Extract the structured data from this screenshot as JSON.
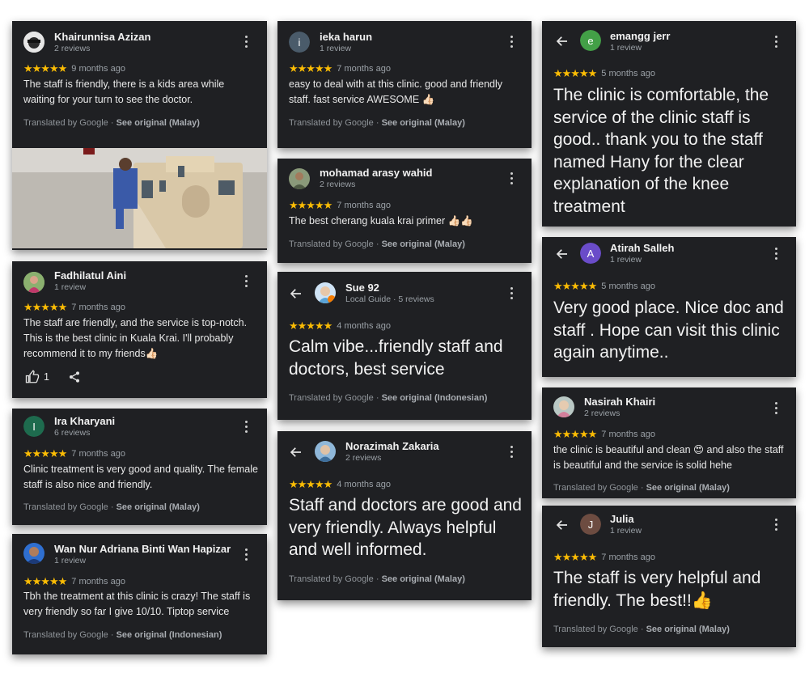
{
  "reviews": [
    {
      "name": "Khairunnisa Azizan",
      "sub": "2 reviews",
      "stars": "★★★★★",
      "when": "9 months ago",
      "text": "The staff is friendly, there is a kids area while waiting for your turn to see the doctor.",
      "translated": "Translated by Google",
      "see": "See original (Malay)",
      "sep": "·",
      "avatar_icon": "person-photo"
    },
    {
      "name": "Fadhilatul Aini",
      "sub": "1 review",
      "stars": "★★★★★",
      "when": "7 months ago",
      "text": "The staff are friendly, and the service is top-notch. This is the best clinic in Kuala Krai. I'll probably recommend it to my friends👍🏻",
      "likes": "1",
      "avatar_icon": "person-photo"
    },
    {
      "name": "Ira Kharyani",
      "sub": "6 reviews",
      "stars": "★★★★★",
      "when": "7 months ago",
      "text": "Clinic treatment is very good and quality. The female staff is also nice and friendly.",
      "translated": "Translated by Google",
      "see": "See original (Malay)",
      "sep": "·",
      "initial": "I",
      "avatar_color": "#1e6b4e"
    },
    {
      "name": "Wan Nur Adriana Binti Wan Hapizar",
      "sub": "1 review",
      "stars": "★★★★★",
      "when": "7 months ago",
      "text": "Tbh the treatment at this clinic is crazy! The staff is very friendly so far I give 10/10. Tiptop service",
      "translated": "Translated by Google",
      "see": "See original (Indonesian)",
      "sep": "·",
      "avatar_icon": "person-photo"
    },
    {
      "name": "ieka harun",
      "sub": "1 review",
      "stars": "★★★★★",
      "when": "7 months ago",
      "text": "easy to deal with at this clinic. good and friendly staff. fast service AWESOME 👍🏻",
      "translated": "Translated by Google",
      "see": "See original (Malay)",
      "sep": "·",
      "initial": "i",
      "avatar_color": "#4a5b6a"
    },
    {
      "name": "mohamad arasy wahid",
      "sub": "2 reviews",
      "stars": "★★★★★",
      "when": "7 months ago",
      "text": "The best cherang kuala krai primer 👍🏻👍🏻",
      "translated": "Translated by Google",
      "see": "See original (Malay)",
      "sep": "·",
      "avatar_icon": "person-photo"
    },
    {
      "name": "Sue 92",
      "sub": "Local Guide",
      "sub2": "5 reviews",
      "dot": "·",
      "stars": "★★★★★",
      "when": "4 months ago",
      "text": "Calm vibe...friendly staff and doctors, best service",
      "translated": "Translated by Google",
      "see": "See original (Indonesian)",
      "sep": "·",
      "avatar_icon": "person-photo"
    },
    {
      "name": "Norazimah Zakaria",
      "sub": "2 reviews",
      "stars": "★★★★★",
      "when": "4 months ago",
      "text": "Staff and doctors are good and very friendly. Always helpful and well informed.",
      "translated": "Translated by Google",
      "see": "See original (Malay)",
      "sep": "·",
      "avatar_icon": "person-photo"
    },
    {
      "name": "emangg jerr",
      "sub": "1 review",
      "stars": "★★★★★",
      "when": "5 months ago",
      "text": "The clinic is comfortable, the service of the clinic staff is good.. thank you to the staff named Hany for the clear explanation of the knee treatment",
      "initial": "e",
      "avatar_color": "#43a047"
    },
    {
      "name": "Atirah Salleh",
      "sub": "1 review",
      "stars": "★★★★★",
      "when": "5 months ago",
      "text": "Very good place. Nice doc and staff . Hope can visit this clinic again anytime..",
      "initial": "A",
      "avatar_color": "#6a4cc9"
    },
    {
      "name": "Nasirah Khairi",
      "sub": "2 reviews",
      "stars": "★★★★★",
      "when": "7 months ago",
      "text": "the clinic is beautiful and clean 😍 and also the staff is beautiful and the service is solid hehe",
      "translated": "Translated by Google",
      "see": "See original (Malay)",
      "sep": "·",
      "avatar_icon": "person-photo"
    },
    {
      "name": "Julia",
      "sub": "1 review",
      "stars": "★★★★★",
      "when": "7 months ago",
      "text": "The staff is very helpful and friendly. The best!!👍",
      "translated": "Translated by Google",
      "see": "See original (Malay)",
      "sep": "·",
      "initial": "J",
      "avatar_color": "#6d4c41"
    }
  ],
  "icons": {
    "back": "back-arrow-icon",
    "more": "more-vert-icon",
    "like": "thumb-up-icon",
    "share": "share-icon"
  }
}
